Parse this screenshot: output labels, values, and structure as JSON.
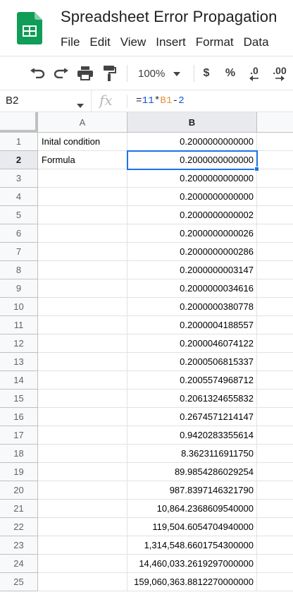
{
  "app": {
    "doc_title": "Spreadsheet Error Propagation",
    "logo_icon": "google-sheets-logo",
    "menu": [
      "File",
      "Edit",
      "View",
      "Insert",
      "Format",
      "Data"
    ]
  },
  "toolbar": {
    "undo_icon": "undo-icon",
    "redo_icon": "redo-icon",
    "print_icon": "print-icon",
    "paint_format_icon": "paint-format-icon",
    "zoom": "100%",
    "currency_label": "$",
    "percent_label": "%",
    "decrease_decimal_label": ".0",
    "increase_decimal_label": ".00"
  },
  "formula_bar": {
    "cell_ref": "B2",
    "fx_label": "fx",
    "formula_parts": {
      "eq": "=",
      "num1": "11",
      "op1": "*",
      "ref": "B1",
      "op2": "-",
      "num2": "2"
    }
  },
  "grid": {
    "columns": [
      "A",
      "B"
    ],
    "selected_cell": "B2",
    "rows": [
      {
        "num": "1",
        "a": "Inital condition",
        "b": "0.2000000000000"
      },
      {
        "num": "2",
        "a": "Formula",
        "b": "0.2000000000000"
      },
      {
        "num": "3",
        "a": "",
        "b": "0.2000000000000"
      },
      {
        "num": "4",
        "a": "",
        "b": "0.2000000000000"
      },
      {
        "num": "5",
        "a": "",
        "b": "0.2000000000002"
      },
      {
        "num": "6",
        "a": "",
        "b": "0.2000000000026"
      },
      {
        "num": "7",
        "a": "",
        "b": "0.2000000000286"
      },
      {
        "num": "8",
        "a": "",
        "b": "0.2000000003147"
      },
      {
        "num": "9",
        "a": "",
        "b": "0.2000000034616"
      },
      {
        "num": "10",
        "a": "",
        "b": "0.2000000380778"
      },
      {
        "num": "11",
        "a": "",
        "b": "0.2000004188557"
      },
      {
        "num": "12",
        "a": "",
        "b": "0.2000046074122"
      },
      {
        "num": "13",
        "a": "",
        "b": "0.2000506815337"
      },
      {
        "num": "14",
        "a": "",
        "b": "0.2005574968712"
      },
      {
        "num": "15",
        "a": "",
        "b": "0.2061324655832"
      },
      {
        "num": "16",
        "a": "",
        "b": "0.2674571214147"
      },
      {
        "num": "17",
        "a": "",
        "b": "0.9420283355614"
      },
      {
        "num": "18",
        "a": "",
        "b": "8.3623116911750"
      },
      {
        "num": "19",
        "a": "",
        "b": "89.9854286029254"
      },
      {
        "num": "20",
        "a": "",
        "b": "987.8397146321790"
      },
      {
        "num": "21",
        "a": "",
        "b": "10,864.2368609540000"
      },
      {
        "num": "22",
        "a": "",
        "b": "119,504.6054704940000"
      },
      {
        "num": "23",
        "a": "",
        "b": "1,314,548.6601754300000"
      },
      {
        "num": "24",
        "a": "",
        "b": "14,460,033.2619297000000"
      },
      {
        "num": "25",
        "a": "",
        "b": "159,060,363.8812270000000"
      }
    ]
  },
  "colors": {
    "sheets_green": "#0f9d58",
    "selection_blue": "#1a73e8",
    "formula_number": "#1155cc",
    "formula_reference": "#e69138"
  }
}
